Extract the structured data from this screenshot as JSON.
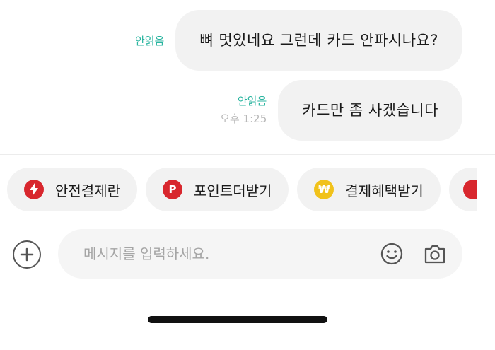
{
  "messages": [
    {
      "text": "뼈 멋있네요 그런데 카드 안파시나요?",
      "status": "안읽음",
      "time": ""
    },
    {
      "text": "카드만 좀 사겠습니다",
      "status": "안읽음",
      "time": "오후 1:25"
    }
  ],
  "quick_actions": [
    {
      "label": "안전결제란",
      "icon": "lightning-icon",
      "glyph": "⚡",
      "color": "#d8272e"
    },
    {
      "label": "포인트더받기",
      "icon": "point-p-icon",
      "glyph": "P",
      "color": "#d8272e"
    },
    {
      "label": "결제혜택받기",
      "icon": "won-coin-icon",
      "glyph": "₩",
      "color": "#f1c21b"
    }
  ],
  "input": {
    "placeholder": "메시지를 입력하세요.",
    "value": ""
  },
  "icons": {
    "plus": "plus-circle-icon",
    "emoji": "smiley-icon",
    "camera": "camera-icon"
  }
}
